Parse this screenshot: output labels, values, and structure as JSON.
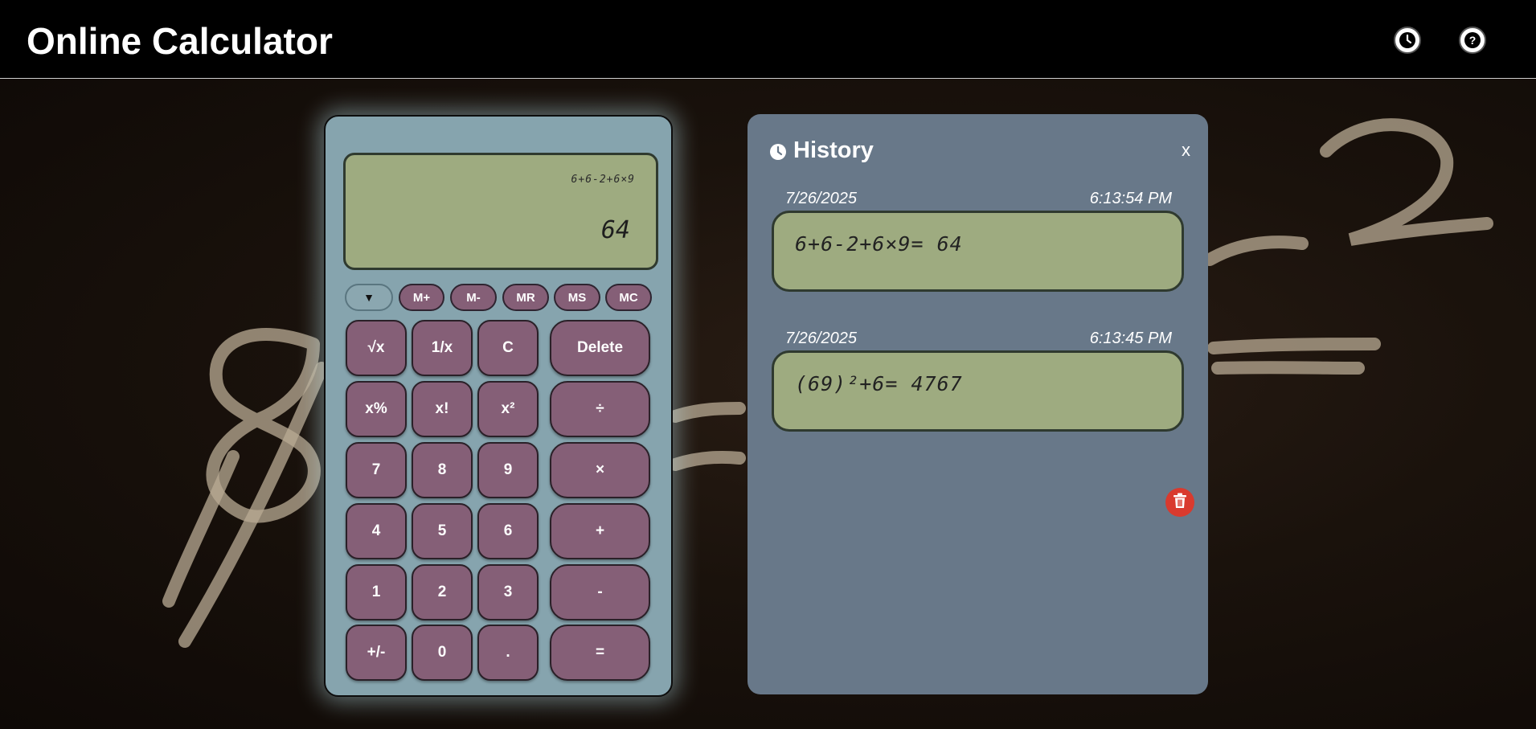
{
  "app": {
    "title": "Online Calculator"
  },
  "topbar": {
    "icons": [
      {
        "name": "history-icon"
      },
      {
        "name": "help-icon"
      }
    ]
  },
  "display": {
    "expression": "6+6-2+6×9",
    "result": "64"
  },
  "memory": {
    "dropdown_glyph": "▼",
    "buttons": [
      "M+",
      "M-",
      "MR",
      "MS",
      "MC"
    ]
  },
  "keys": {
    "sqrt": "√x",
    "reciprocal": "1/x",
    "clear": "C",
    "delete": "Delete",
    "percent": "x%",
    "factorial": "x!",
    "square": "x²",
    "divide": "÷",
    "seven": "7",
    "eight": "8",
    "nine": "9",
    "multiply": "×",
    "four": "4",
    "five": "5",
    "six": "6",
    "plus": "+",
    "one": "1",
    "two": "2",
    "three": "3",
    "minus": "-",
    "negate": "+/-",
    "zero": "0",
    "decimal": ".",
    "equals": "="
  },
  "history": {
    "title": "History",
    "close_label": "x",
    "entries": [
      {
        "date": "7/26/2025",
        "time": "6:13:54 PM",
        "expression": "6+6-2+6×9= 64"
      },
      {
        "date": "7/26/2025",
        "time": "6:13:45 PM",
        "expression": "(69)²+6= 4767"
      }
    ]
  },
  "colors": {
    "calculator_body": "#86a4ae",
    "key": "#855f77",
    "display_lcd": "#9eab80",
    "history_panel": "#687889",
    "trash": "#d93a2e"
  }
}
